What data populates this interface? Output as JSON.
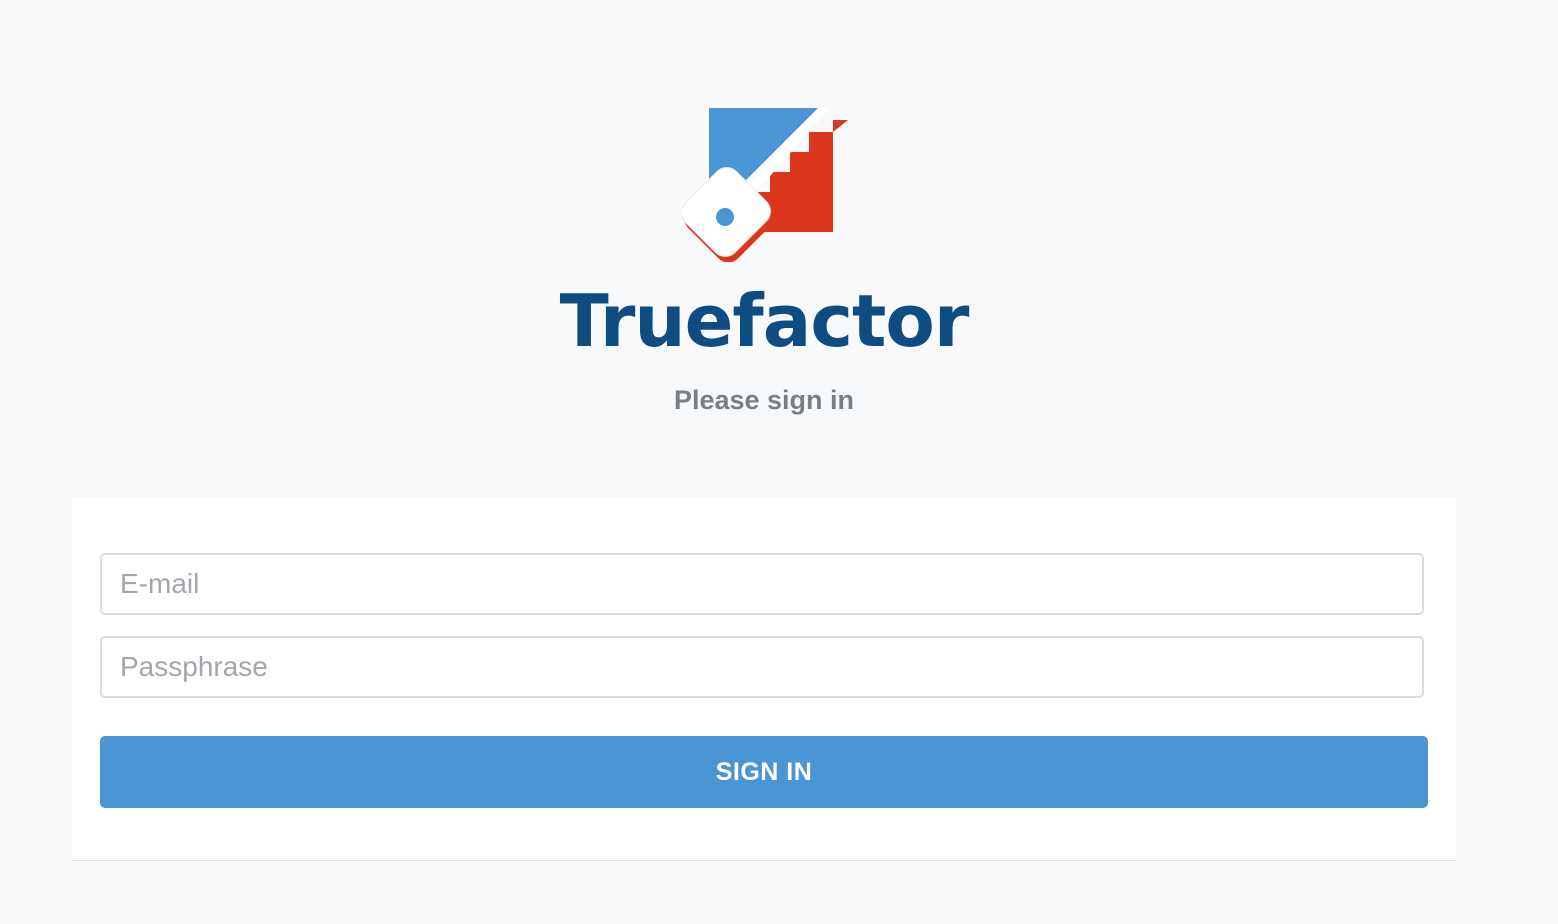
{
  "brand": {
    "name": "Truefactor",
    "logo_icon": "key-staircase-logo-icon",
    "colors": {
      "name": "#0f4c81",
      "blue": "#4a95d4",
      "red": "#dc361d"
    }
  },
  "header": {
    "subtitle": "Please sign in"
  },
  "form": {
    "email_placeholder": "E-mail",
    "email_value": "",
    "passphrase_placeholder": "Passphrase",
    "passphrase_value": "",
    "submit_label": "SIGN IN"
  }
}
